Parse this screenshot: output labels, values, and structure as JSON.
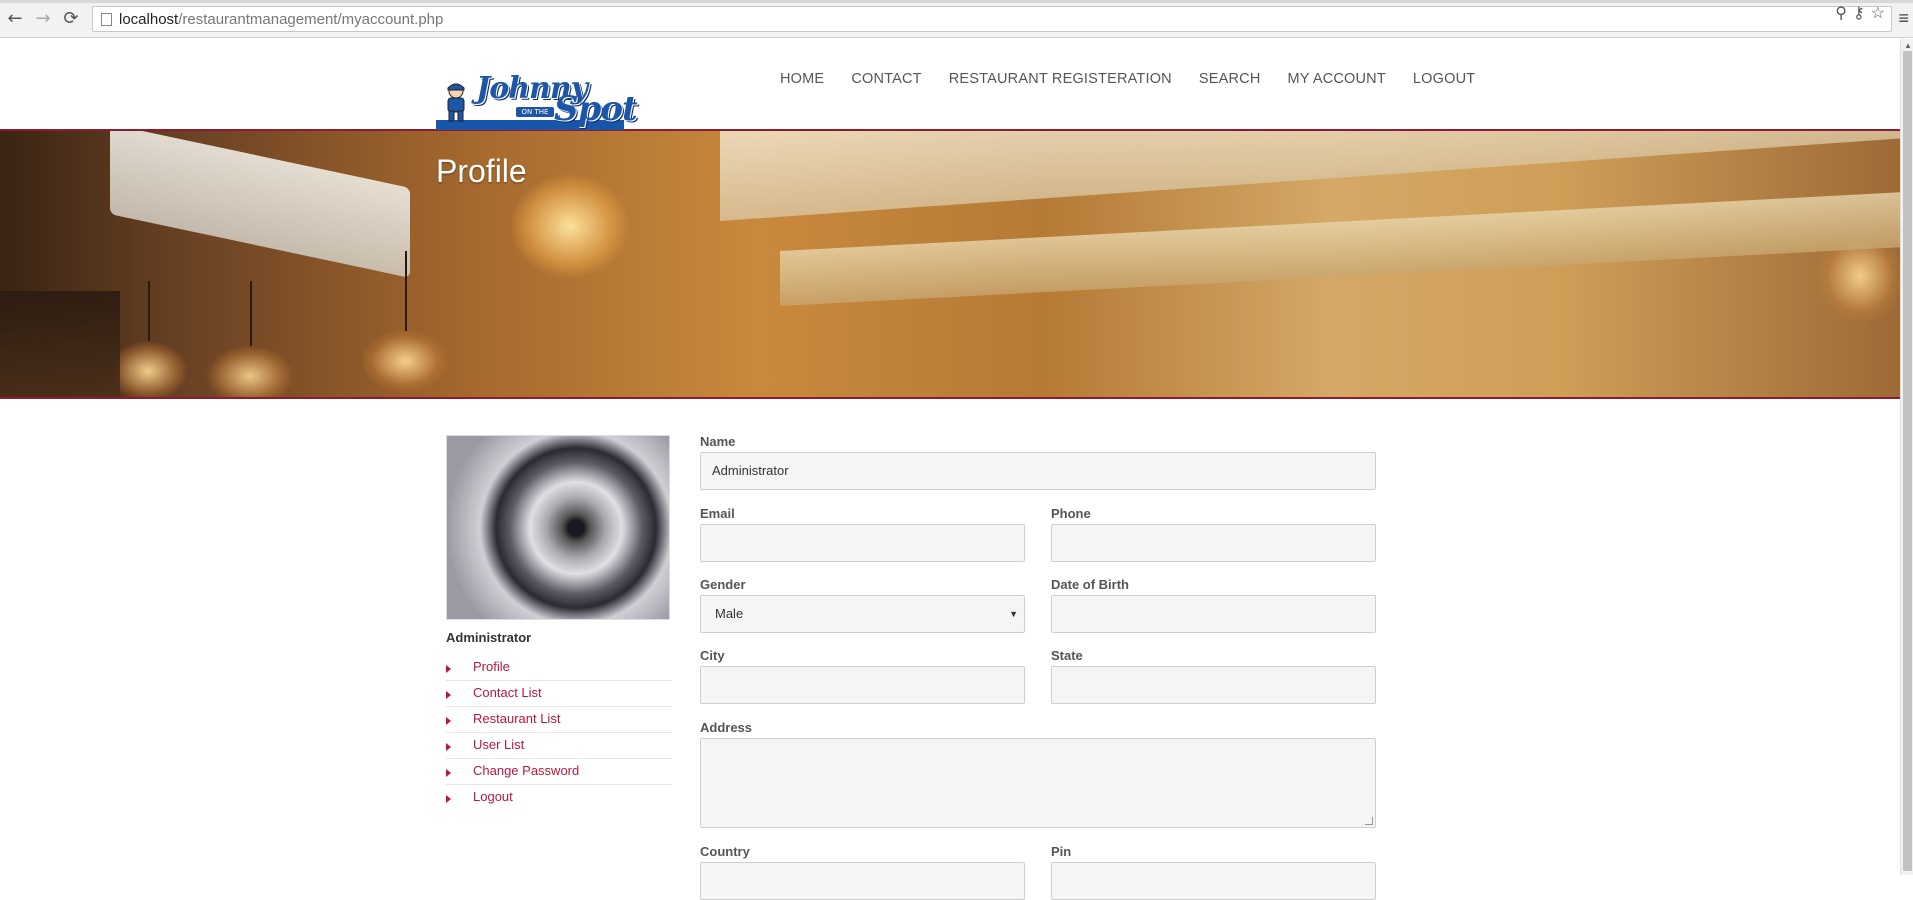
{
  "browser": {
    "url_host": "localhost",
    "url_path": "/restaurantmanagement/myaccount.php"
  },
  "site": {
    "logo": {
      "word1": "Johnny",
      "word2": "Spot",
      "on_the": "ON THE"
    },
    "nav": [
      "HOME",
      "CONTACT",
      "RESTAURANT REGISTERATION",
      "SEARCH",
      "MY ACCOUNT",
      "LOGOUT"
    ]
  },
  "banner": {
    "title": "Profile"
  },
  "sidebar": {
    "user_name": "Administrator",
    "menu": [
      "Profile",
      "Contact List",
      "Restaurant List",
      "User List",
      "Change Password",
      "Logout"
    ]
  },
  "form": {
    "name_label": "Name",
    "name_value": "Administrator",
    "email_label": "Email",
    "email_value": "",
    "phone_label": "Phone",
    "phone_value": "",
    "gender_label": "Gender",
    "gender_value": "Male",
    "dob_label": "Date of Birth",
    "dob_value": "",
    "city_label": "City",
    "city_value": "",
    "state_label": "State",
    "state_value": "",
    "address_label": "Address",
    "address_value": "",
    "country_label": "Country",
    "pin_label": "Pin"
  },
  "colors": {
    "accent": "#b8183a",
    "brand_blue": "#1756a9"
  }
}
